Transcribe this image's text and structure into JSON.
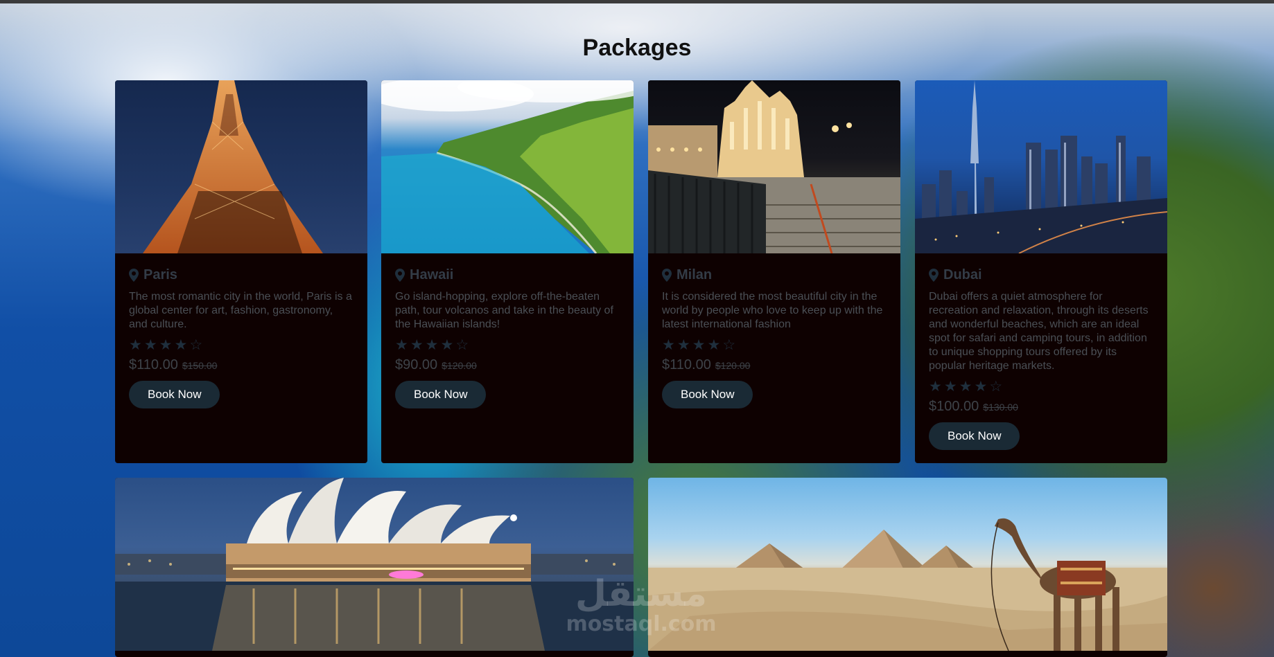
{
  "page": {
    "title": "Packages"
  },
  "colors": {
    "card_bg": "#0e0101",
    "button_bg": "#1a2a35",
    "button_text": "#ffffff",
    "text_muted": "#4a4f55"
  },
  "packages": [
    {
      "name": "Paris",
      "description": "The most romantic city in the world, Paris is a global center for art, fashion, gastronomy, and culture.",
      "rating": 4,
      "rating_max": 5,
      "price": "$110.00",
      "old_price": "$150.00",
      "button": "Book Now",
      "icon": "map-pin-icon"
    },
    {
      "name": "Hawaii",
      "description": "Go island-hopping, explore off-the-beaten path, tour volcanos and take in the beauty of the Hawaiian islands!",
      "rating": 4,
      "rating_max": 5,
      "price": "$90.00",
      "old_price": "$120.00",
      "button": "Book Now",
      "icon": "map-pin-icon"
    },
    {
      "name": "Milan",
      "description": "It is considered the most beautiful city in the world by people who love to keep up with the latest international fashion",
      "rating": 4,
      "rating_max": 5,
      "price": "$110.00",
      "old_price": "$120.00",
      "button": "Book Now",
      "icon": "map-pin-icon"
    },
    {
      "name": "Dubai",
      "description": "Dubai offers a quiet atmosphere for recreation and relaxation, through its deserts and wonderful beaches, which are an ideal spot for safari and camping tours, in addition to unique shopping tours offered by its popular heritage markets.",
      "rating": 4,
      "rating_max": 5,
      "price": "$100.00",
      "old_price": "$130.00",
      "button": "Book Now",
      "icon": "map-pin-icon"
    }
  ],
  "wide_cards": [
    {
      "image": "sydney-opera-house-image"
    },
    {
      "image": "egypt-pyramids-image"
    }
  ],
  "watermark": {
    "latin": "mostaql.com",
    "arabic": "مستقل"
  }
}
